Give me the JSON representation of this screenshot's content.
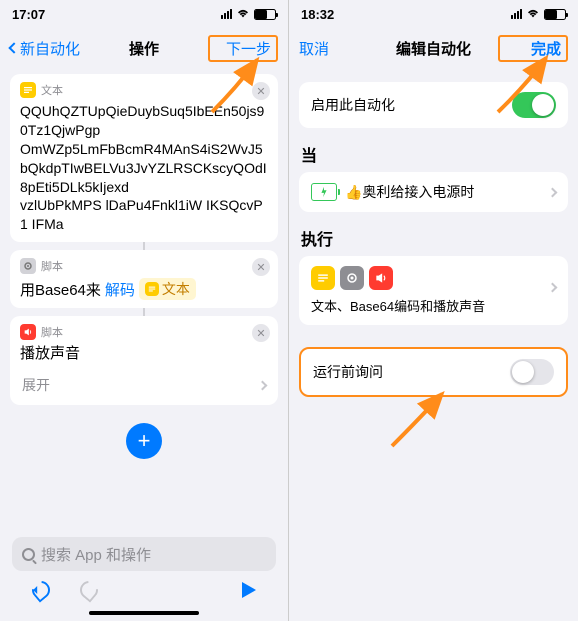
{
  "left": {
    "status_time": "17:07",
    "nav_back": "新自动化",
    "nav_title": "操作",
    "nav_next": "下一步",
    "text_card": {
      "tag": "文本",
      "body": "QQUhQZTUpQieDuybSuq5IbEEn50js90Tz1QjwPgp\nOmWZp5LmFbBcmR4MAnS4iS2WvJ5bQkdpTIwBELVu3JvYZLRSCKscyQOdI8pEti5DLk5kIjexd\nvzlUbPkMPS lDaPu4Fnkl1iW IKSQcvP1 IFMa"
    },
    "script_card": {
      "tag": "脚本",
      "prefix": "用Base64来",
      "action": "解码",
      "pill_label": "文本"
    },
    "sound_card": {
      "tag": "脚本",
      "title": "播放声音"
    },
    "expand": "展开",
    "search_placeholder": "搜索 App 和操作"
  },
  "right": {
    "status_time": "18:32",
    "nav_cancel": "取消",
    "nav_title": "编辑自动化",
    "nav_done": "完成",
    "enable_label": "启用此自动化",
    "when_label": "当",
    "when_text": "👍奥利给接入电源时",
    "exec_label": "执行",
    "exec_text": "文本、Base64编码和播放声音",
    "ask_label": "运行前询问"
  }
}
